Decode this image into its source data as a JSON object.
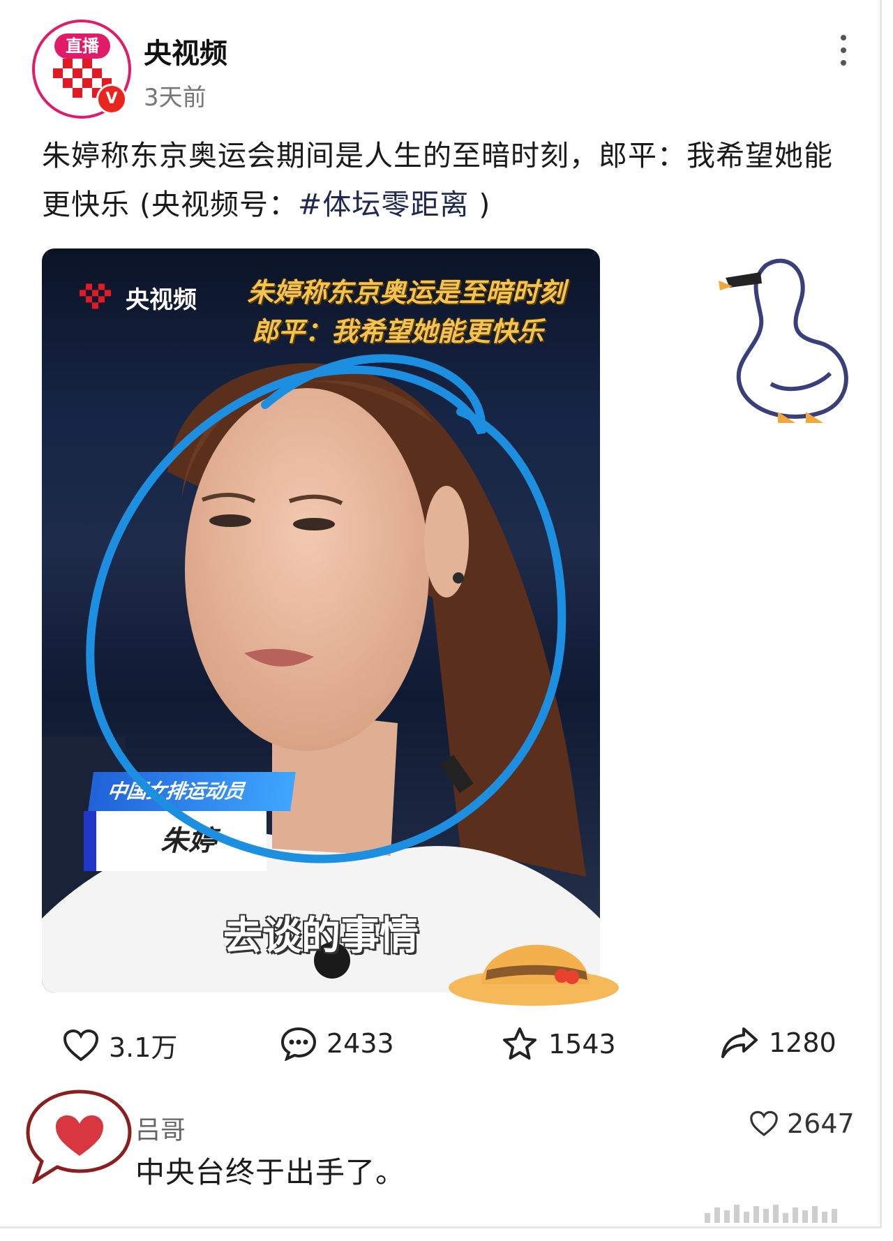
{
  "header": {
    "author": "央视频",
    "time": "3天前",
    "avatar_live_label": "直播",
    "verified_badge": "V"
  },
  "post": {
    "text_main": "朱婷称东京奥运会期间是人生的至暗时刻，郎平：我希望她能更快乐 (央视频号：",
    "hashtag": "#体坛零距离",
    "text_end": " )"
  },
  "media": {
    "logo_text": "央视频",
    "title_line1": "朱婷称东京奥运是至暗时刻",
    "title_line2": "郎平：我希望她能更快乐",
    "nameplate_role": "中国女排运动员",
    "nameplate_name": "朱婷",
    "subtitle": "去谈的事情"
  },
  "actions": {
    "likes": "3.1万",
    "comments": "2433",
    "favorites": "1543",
    "shares": "1280"
  },
  "comment": {
    "author": "吕哥",
    "text": "中央台终于出手了。",
    "likes": "2647"
  },
  "colors": {
    "brand_pink": "#e21a6a",
    "hashtag": "#20294f",
    "overlay_circle": "#1d8fe0",
    "media_title": "#f4c451"
  },
  "icons": [
    "more-icon",
    "heart-icon",
    "comment-icon",
    "star-icon",
    "share-icon",
    "goose-sticker",
    "hat-sticker",
    "heart-bubble-sticker"
  ]
}
